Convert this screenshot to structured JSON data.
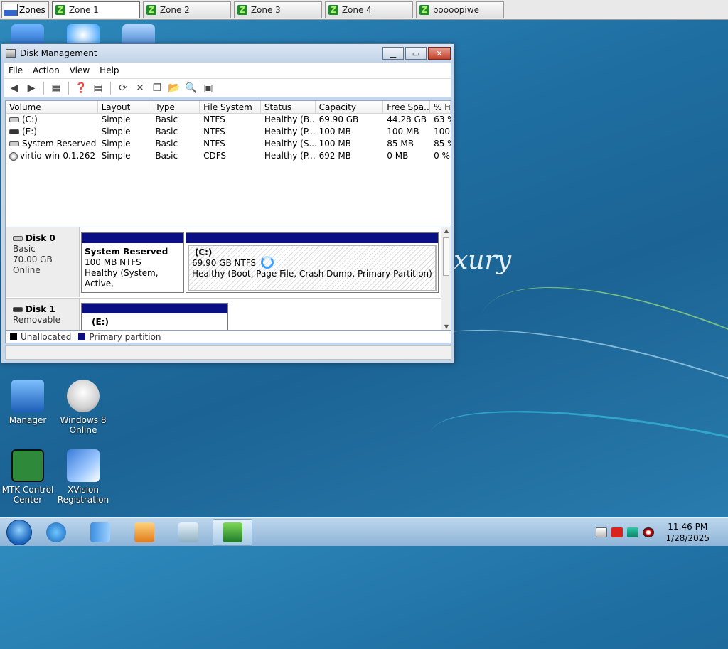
{
  "zones_bar": {
    "zones_label": "Zones",
    "tabs": [
      "Zone 1",
      "Zone 2",
      "Zone 3",
      "Zone 4",
      "poooopiwe"
    ]
  },
  "desktop": {
    "wallpaper_text": "xury",
    "icons": [
      {
        "label": "Manager",
        "icon": "wrench-icon"
      },
      {
        "label": "Windows 8 Online",
        "icon": "windows-icon"
      },
      {
        "label": "MTK Control Center",
        "icon": "mtk-icon"
      },
      {
        "label": "XVision Registration",
        "icon": "xvision-icon"
      }
    ]
  },
  "window": {
    "title": "Disk Management",
    "controls": {
      "minimize": "▁",
      "maximize": "▭",
      "close": "✕"
    },
    "menu": [
      "File",
      "Action",
      "View",
      "Help"
    ],
    "volumes": {
      "columns": [
        "Volume",
        "Layout",
        "Type",
        "File System",
        "Status",
        "Capacity",
        "Free Spa...",
        "% Fr"
      ],
      "rows": [
        [
          "(C:)",
          "Simple",
          "Basic",
          "NTFS",
          "Healthy (B...",
          "69.90 GB",
          "44.28 GB",
          "63 %"
        ],
        [
          "(E:)",
          "Simple",
          "Basic",
          "NTFS",
          "Healthy (P...",
          "100 MB",
          "100 MB",
          "100"
        ],
        [
          "System Reserved",
          "Simple",
          "Basic",
          "NTFS",
          "Healthy (S...",
          "100 MB",
          "85 MB",
          "85 %"
        ],
        [
          "virtio-win-0.1.262 ...",
          "Simple",
          "Basic",
          "CDFS",
          "Healthy (P...",
          "692 MB",
          "0 MB",
          "0 %"
        ]
      ]
    },
    "disks": [
      {
        "name": "Disk 0",
        "type": "Basic",
        "size": "70.00 GB",
        "state": "Online",
        "partitions": [
          {
            "name": "System Reserved",
            "size": "100 MB NTFS",
            "status": "Healthy (System, Active,"
          },
          {
            "name": "(C:)",
            "size": "69.90 GB NTFS",
            "status": "Healthy (Boot, Page File, Crash Dump, Primary Partition)"
          }
        ]
      },
      {
        "name": "Disk 1",
        "type": "Removable",
        "partitions": [
          {
            "name": "(E:)"
          }
        ]
      }
    ],
    "legend": [
      {
        "label": "Unallocated",
        "color": "#000000"
      },
      {
        "label": "Primary partition",
        "color": "#0a0f84"
      }
    ]
  },
  "taskbar": {
    "time": "11:46 PM",
    "date": "1/28/2025"
  }
}
